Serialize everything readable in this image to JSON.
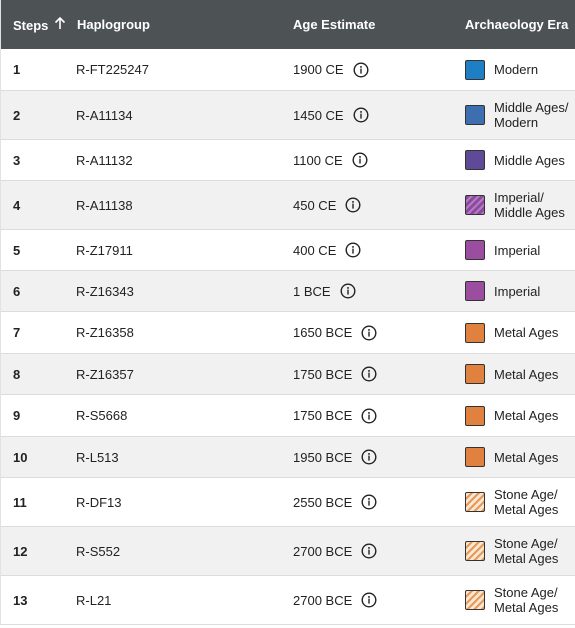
{
  "header": {
    "steps_label": "Steps",
    "haplogroup_label": "Haplogroup",
    "age_label": "Age Estimate",
    "era_label": "Archaeology Era",
    "sort_icon": "arrow-up-icon"
  },
  "colors": {
    "header_bg": "#4d5254",
    "modern": "#1f7fc4",
    "middle_modern": "#3d6fb0",
    "middle": "#5e4a96",
    "imperial_middle": "#8a4a9e",
    "imperial": "#9b4da0",
    "metal": "#e0813f",
    "stone_metal": "#f2c79b"
  },
  "rows": [
    {
      "step": "1",
      "haplogroup": "R-FT225247",
      "age": "1900 CE",
      "era_line1": "Modern",
      "era_line2": "",
      "swatch": "modern"
    },
    {
      "step": "2",
      "haplogroup": "R-A11134",
      "age": "1450 CE",
      "era_line1": "Middle Ages/",
      "era_line2": "Modern",
      "swatch": "middle_modern"
    },
    {
      "step": "3",
      "haplogroup": "R-A11132",
      "age": "1100 CE",
      "era_line1": "Middle Ages",
      "era_line2": "",
      "swatch": "middle"
    },
    {
      "step": "4",
      "haplogroup": "R-A11138",
      "age": "450 CE",
      "era_line1": "Imperial/",
      "era_line2": "Middle Ages",
      "swatch": "imperial_middle"
    },
    {
      "step": "5",
      "haplogroup": "R-Z17911",
      "age": "400 CE",
      "era_line1": "Imperial",
      "era_line2": "",
      "swatch": "imperial"
    },
    {
      "step": "6",
      "haplogroup": "R-Z16343",
      "age": "1 BCE",
      "era_line1": "Imperial",
      "era_line2": "",
      "swatch": "imperial"
    },
    {
      "step": "7",
      "haplogroup": "R-Z16358",
      "age": "1650 BCE",
      "era_line1": "Metal Ages",
      "era_line2": "",
      "swatch": "metal"
    },
    {
      "step": "8",
      "haplogroup": "R-Z16357",
      "age": "1750 BCE",
      "era_line1": "Metal Ages",
      "era_line2": "",
      "swatch": "metal"
    },
    {
      "step": "9",
      "haplogroup": "R-S5668",
      "age": "1750 BCE",
      "era_line1": "Metal Ages",
      "era_line2": "",
      "swatch": "metal"
    },
    {
      "step": "10",
      "haplogroup": "R-L513",
      "age": "1950 BCE",
      "era_line1": "Metal Ages",
      "era_line2": "",
      "swatch": "metal"
    },
    {
      "step": "11",
      "haplogroup": "R-DF13",
      "age": "2550 BCE",
      "era_line1": "Stone Age/",
      "era_line2": "Metal Ages",
      "swatch": "stone_metal"
    },
    {
      "step": "12",
      "haplogroup": "R-S552",
      "age": "2700 BCE",
      "era_line1": "Stone Age/",
      "era_line2": "Metal Ages",
      "swatch": "stone_metal"
    },
    {
      "step": "13",
      "haplogroup": "R-L21",
      "age": "2700 BCE",
      "era_line1": "Stone Age/",
      "era_line2": "Metal Ages",
      "swatch": "stone_metal"
    }
  ]
}
